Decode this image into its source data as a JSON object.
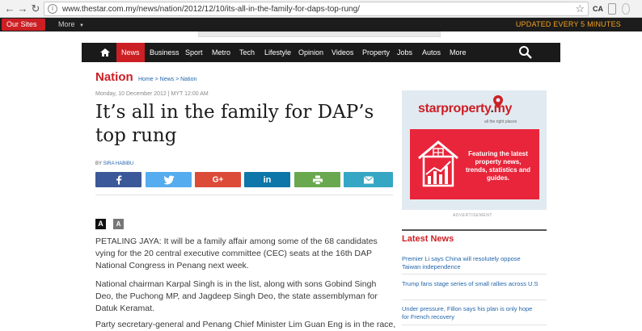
{
  "browser": {
    "url": "www.thestar.com.my/news/nation/2012/12/10/its-all-in-the-family-for-daps-top-rung/",
    "extensions": [
      "CA",
      "",
      ""
    ]
  },
  "site_bar": {
    "our_sites": "Our Sites",
    "more": "More",
    "updated": "UPDATED EVERY 5 MINUTES"
  },
  "nav": {
    "items": [
      "News",
      "Business",
      "Sport",
      "Metro",
      "Tech",
      "Lifestyle",
      "Opinion",
      "Videos",
      "Property",
      "Jobs",
      "Autos",
      "More"
    ],
    "active": "News"
  },
  "article": {
    "section": "Nation",
    "breadcrumb": "Home > News > Nation",
    "dateline": "Monday, 10 December 2012 | MYT 12:00 AM",
    "headline": "It’s all in the family for DAP’s top rung",
    "by_prefix": "BY",
    "author": "SIRA HABIBU",
    "font_large": "A",
    "font_small": "A",
    "paragraphs": [
      "PETALING JAYA: It will be a family affair among some of the 68 candidates vying for the 20 central executive committee (CEC) seats at the 16th DAP National Congress in Penang next week.",
      "National chairman Karpal Singh is in the list, along with sons Gobind Singh Deo, the Puchong MP, and Jagdeep Singh Deo, the state assemblyman for Datuk Keramat.",
      "Party secretary-general and Penang Chief Minister Lim Guan Eng is in the race,"
    ]
  },
  "share": [
    {
      "name": "facebook",
      "color": "#3b5998",
      "icon": "facebook-icon"
    },
    {
      "name": "twitter",
      "color": "#55acee",
      "icon": "twitter-icon"
    },
    {
      "name": "googleplus",
      "color": "#dc4a38",
      "icon": "google-plus-icon"
    },
    {
      "name": "linkedin",
      "color": "#0e76a8",
      "icon": "linkedin-icon"
    },
    {
      "name": "print",
      "color": "#6aa84f",
      "icon": "print-icon"
    },
    {
      "name": "email",
      "color": "#35a7c4",
      "icon": "mail-icon"
    }
  ],
  "ad": {
    "logo_a": "starproperty",
    "logo_dot": ".",
    "logo_b": "my",
    "tagline": "all the right places",
    "promo": "Featuring the latest property news, trends, statistics and guides.",
    "label": "ADVERTISEMENT"
  },
  "latest": {
    "title": "Latest News",
    "items": [
      "Premier Li says China will resolutely oppose Taiwan independence",
      "Trump fans stage series of small rallies across U.S",
      "Under pressure, Fillon says his plan is only hope for French recovery"
    ]
  },
  "colors": {
    "brand_red": "#cc1f24",
    "link_blue": "#2266aa",
    "nav_bg": "#1a1a1a",
    "updated_orange": "#f4a21d"
  }
}
